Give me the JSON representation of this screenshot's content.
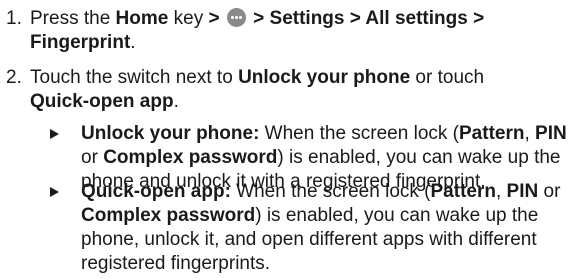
{
  "steps": [
    {
      "number": "1.",
      "line1": {
        "t1": "Press the ",
        "b1": "Home",
        "t2": " key ",
        "b2": ">",
        "icon": "apps-icon",
        "b3": "> Settings > All settings >"
      },
      "line2": {
        "b1": "Fingerprint",
        "t1": "."
      }
    },
    {
      "number": "2.",
      "line1": {
        "t1": "Touch the switch next to ",
        "b1": "Unlock your phone",
        "t2": " or touch"
      },
      "line2": {
        "b1": "Quick-open app",
        "t1": "."
      }
    }
  ],
  "bullets": [
    {
      "lines": [
        {
          "b1": "Unlock your phone:",
          "t1": " When the screen lock (",
          "b2": "Pattern",
          "t2": ", ",
          "b3": "PIN"
        },
        {
          "t1": "or ",
          "b1": "Complex password",
          "t2": ") is enabled, you can wake up the"
        },
        {
          "t1": "phone and unlock it with a registered fingerprint."
        }
      ]
    },
    {
      "lines": [
        {
          "b1": "Quick-open app:",
          "t1": " When the screen lock (",
          "b2": "Pattern",
          "t2": ", ",
          "b3": "PIN",
          "t3": " or"
        },
        {
          "b1": "Complex password",
          "t1": ") is enabled, you can wake up the"
        },
        {
          "t1": "phone, unlock it, and open different apps with different"
        },
        {
          "t1": "registered fingerprints."
        }
      ]
    }
  ]
}
